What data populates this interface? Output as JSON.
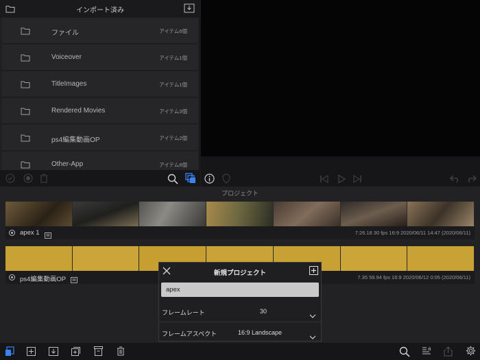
{
  "import_panel": {
    "title": "インポート済み",
    "items": [
      {
        "name": "ファイル",
        "count": "アイテム6個"
      },
      {
        "name": "Voiceover",
        "count": "アイテム1個"
      },
      {
        "name": "TitleImages",
        "count": "アイテム1個"
      },
      {
        "name": "Rendered Movies",
        "count": "アイテム3個"
      },
      {
        "name": "ps4編集動画OP",
        "count": "アイテム2個"
      },
      {
        "name": "Other-App",
        "count": "アイテム6個"
      }
    ]
  },
  "projects_section": {
    "title": "プロジェクト",
    "projects": [
      {
        "name": "apex 1",
        "meta": "7:26.18   30 fps   16:9   2020/06/11 14:47   (2020/06/11)"
      },
      {
        "name": "ps4編集動画OP",
        "meta": "7.35   59.94 fps   16:9   2020/06/12 0:05   (2020/06/11)"
      }
    ]
  },
  "new_project_dialog": {
    "title": "新規プロジェクト",
    "name_value": "apex",
    "framerate_label": "フレームレート",
    "framerate_value": "30",
    "aspect_label": "フレームアスペクト",
    "aspect_value": "16:9  Landscape"
  },
  "colors": {
    "accent": "#3b82f6",
    "background": "#1c1c1e"
  },
  "icons": [
    "folder-icon",
    "import-icon",
    "check-icon",
    "record-icon",
    "trash-icon",
    "search-icon",
    "media-browser-icon",
    "info-icon",
    "marker-icon",
    "skip-back-icon",
    "play-icon",
    "skip-forward-icon",
    "undo-icon",
    "redo-icon",
    "close-icon",
    "add-icon",
    "chevron-down-icon",
    "settings-icon",
    "share-icon",
    "text-icon"
  ]
}
